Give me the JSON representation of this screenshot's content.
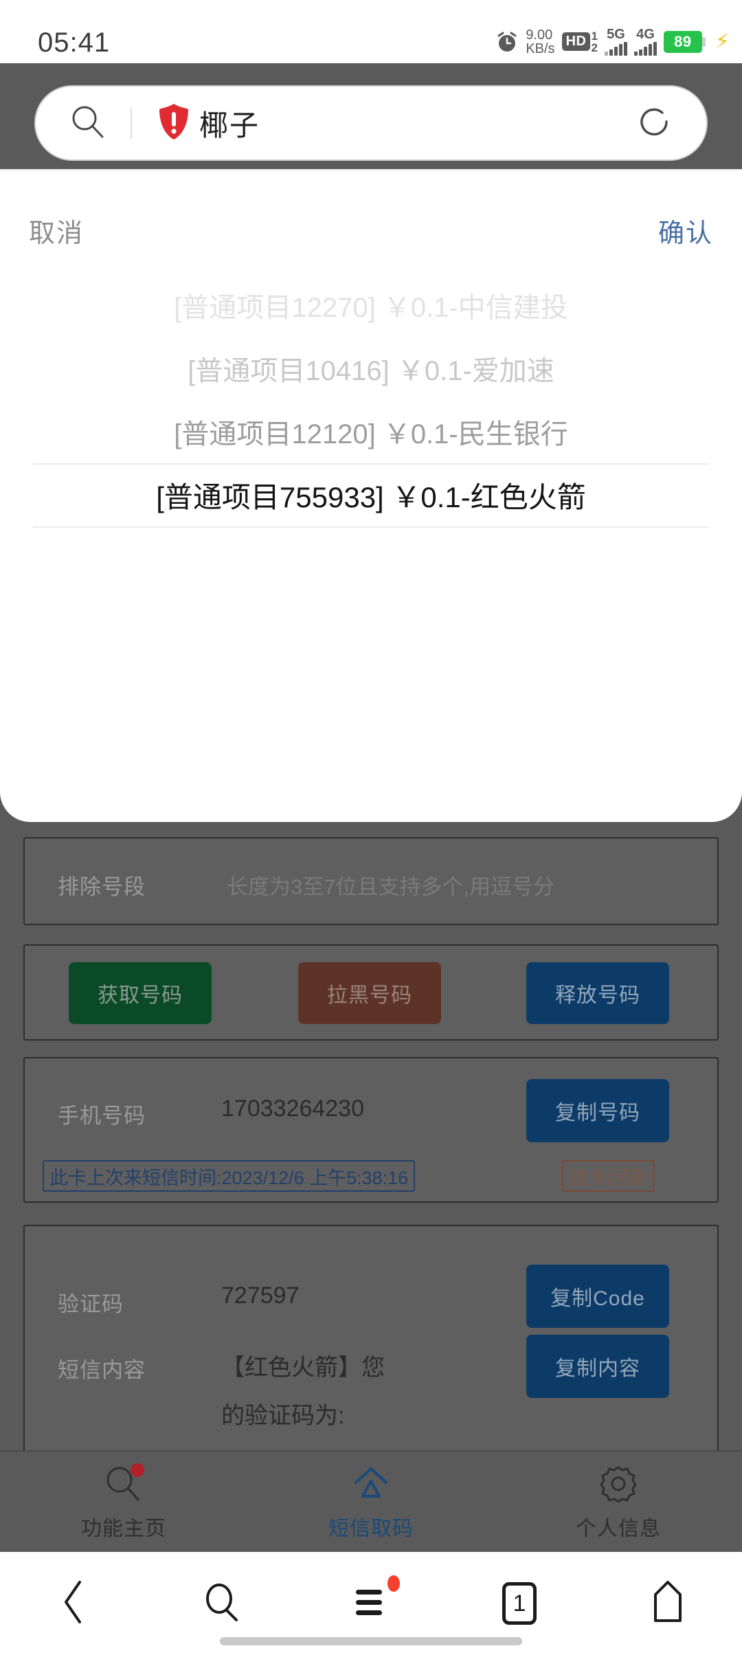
{
  "statusbar": {
    "time": "05:41",
    "alarm_icon": "alarm-clock-icon",
    "net_speed_value": "9.00",
    "net_speed_unit": "KB/s",
    "hd_badge": "HD",
    "hd_sup": "1",
    "hd_sub": "2",
    "sim1_network": "5G",
    "sim2_network": "4G",
    "battery_percent": "89",
    "charging_icon": "lightning-bolt-icon"
  },
  "searchbar": {
    "search_icon": "search-icon",
    "warning_icon": "shield-warning-icon",
    "query": "椰子",
    "refresh_icon": "refresh-icon"
  },
  "sheet": {
    "cancel_label": "取消",
    "confirm_label": "确认",
    "picker_items": [
      "[普通项目12270] ￥0.1-中信建投",
      "[普通项目10416] ￥0.1-爱加速",
      "[普通项目12120] ￥0.1-民生银行",
      "[普通项目755933] ￥0.1-红色火箭"
    ],
    "selected_index": 3
  },
  "background": {
    "exclude_prefix": {
      "label": "排除号段",
      "placeholder": "长度为3至7位且支持多个,用逗号分"
    },
    "actions": {
      "get_number": "获取号码",
      "blacklist_number": "拉黑号码",
      "release_number": "释放号码"
    },
    "phone": {
      "label": "手机号码",
      "value": "17033264230",
      "copy_label": "复制号码"
    },
    "sms_time_note": "此卡上次来短信时间:2023/12/6 上午5:38:16",
    "card_tag": "虚卡|河南",
    "code": {
      "label": "验证码",
      "value": "727597",
      "copy_label": "复制Code"
    },
    "sms": {
      "label": "短信内容",
      "line1": "【红色火箭】您",
      "line2": "的验证码为:",
      "copy_label": "复制内容"
    }
  },
  "tabbar": {
    "tabs": [
      {
        "label": "功能主页",
        "icon": "search-icon",
        "badge": true,
        "active": false
      },
      {
        "label": "短信取码",
        "icon": "home-icon",
        "badge": false,
        "active": true
      },
      {
        "label": "个人信息",
        "icon": "gear-icon",
        "badge": false,
        "active": false
      }
    ]
  },
  "navbar": {
    "back_icon": "back-chevron-icon",
    "search_icon": "search-icon",
    "menu_icon": "menu-hamburger-icon",
    "tab_count": "1",
    "home_icon": "home-pentagon-icon"
  },
  "colors": {
    "accent_blue": "#0d3b68",
    "green": "#0b4a26",
    "brown": "#5e3327",
    "battery_green": "#27c24c",
    "badge_red": "#b2202a",
    "warn_red": "#e02b33"
  }
}
